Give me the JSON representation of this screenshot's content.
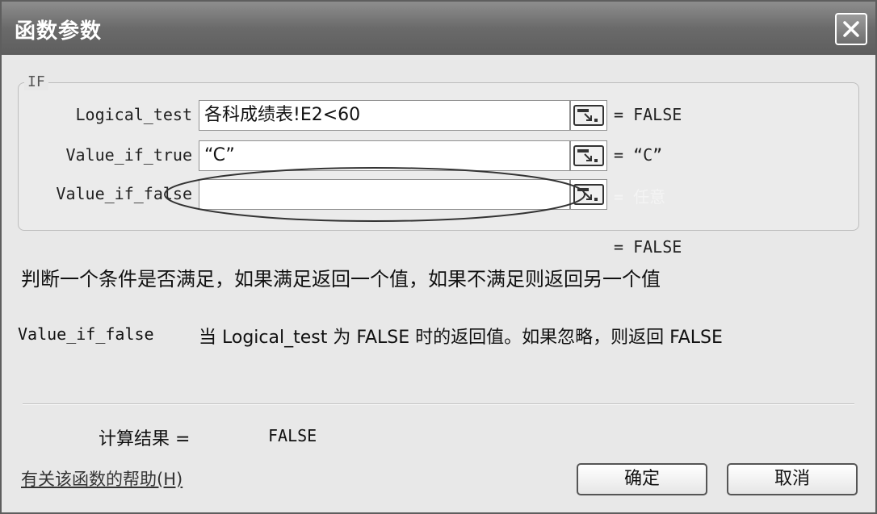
{
  "dialog": {
    "title": "函数参数",
    "close_glyph": "×"
  },
  "function_group": {
    "name": "IF",
    "args": [
      {
        "label": "Logical_test",
        "value": "各科成绩表!E2<60",
        "result": "= FALSE"
      },
      {
        "label": "Value_if_true",
        "value": "“C”",
        "result": "= “C”"
      },
      {
        "label": "Value_if_false",
        "value": "",
        "result": "= 任意"
      }
    ]
  },
  "overall_result_preview": "= FALSE",
  "description": "判断一个条件是否满足，如果满足返回一个值，如果不满足则返回另一个值",
  "arg_help": {
    "name": "Value_if_false",
    "text": "当 Logical_test 为 FALSE 时的返回值。如果忽略，则返回 FALSE"
  },
  "calc": {
    "label": "计算结果 =",
    "value": "FALSE"
  },
  "help_link": "有关该函数的帮助(H)",
  "buttons": {
    "ok": "确定",
    "cancel": "取消"
  }
}
